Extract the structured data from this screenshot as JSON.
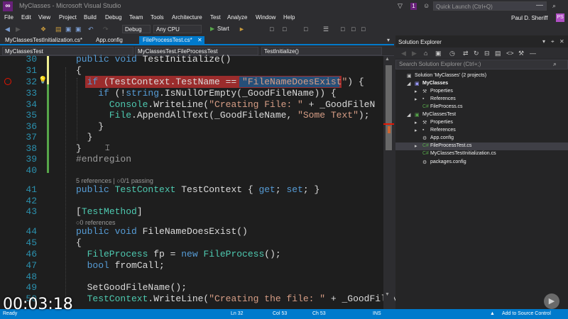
{
  "window": {
    "title": "MyClasses - Microsoft Visual Studio",
    "notification_count": "1",
    "quick_launch_placeholder": "Quick Launch (Ctrl+Q)",
    "user_name": "Paul D. Sheriff",
    "user_initials": "PS",
    "min_glyph": "—"
  },
  "menu": [
    "File",
    "Edit",
    "View",
    "Project",
    "Build",
    "Debug",
    "Team",
    "Tools",
    "Architecture",
    "Test",
    "Analyze",
    "Window",
    "Help"
  ],
  "toolbar": {
    "config": "Debug",
    "platform": "Any CPU",
    "start_label": "Start",
    "start_glyph": "▶",
    "icons": {
      "back": "◀",
      "forward": "▶",
      "new": "❖",
      "open": "▤",
      "save": "▣",
      "save_all": "▣",
      "undo": "↶",
      "redo": "↷",
      "attach": "►",
      "dropdown": "▾"
    }
  },
  "doc_tabs": [
    {
      "label": "MyClassesTestInitialization.cs*"
    },
    {
      "label": "App.config"
    },
    {
      "label": "FileProcessTest.cs*"
    }
  ],
  "nav": {
    "project": "MyClassesTest",
    "class": "MyClassesTest.FileProcessTest",
    "member": "TestInitialize()"
  },
  "editor": {
    "breakpoint_line": "32",
    "lines": [
      {
        "n": "30",
        "parts": [
          [
            "kw",
            "public "
          ],
          [
            "kw",
            "void "
          ],
          [
            "",
            "TestInitialize()"
          ]
        ]
      },
      {
        "n": "31",
        "parts": [
          [
            "",
            "{"
          ]
        ]
      },
      {
        "n": "32",
        "parts": [
          [
            "kw",
            "if "
          ],
          [
            "",
            "(TestContext.TestName == "
          ],
          [
            "str",
            "\"FileNameDoesExist\""
          ],
          [
            "",
            ") {"
          ]
        ]
      },
      {
        "n": "33",
        "parts": [
          [
            "kw",
            "if "
          ],
          [
            "",
            "(!"
          ],
          [
            "kw",
            "string"
          ],
          [
            "",
            ".IsNullOrEmpty(_GoodFileName)) {"
          ]
        ]
      },
      {
        "n": "34",
        "parts": [
          [
            "ty",
            "Console"
          ],
          [
            "",
            ".WriteLine("
          ],
          [
            "str",
            "\"Creating File: \""
          ],
          [
            "",
            " + _GoodFileN"
          ]
        ]
      },
      {
        "n": "35",
        "parts": [
          [
            "ty",
            "File"
          ],
          [
            "",
            ".AppendAllText(_GoodFileName, "
          ],
          [
            "str",
            "\"Some Text\""
          ],
          [
            "",
            ");"
          ]
        ]
      },
      {
        "n": "36",
        "parts": [
          [
            "",
            "}"
          ]
        ]
      },
      {
        "n": "37",
        "parts": [
          [
            "",
            "}"
          ]
        ]
      },
      {
        "n": "38",
        "parts": [
          [
            "",
            "}"
          ]
        ]
      },
      {
        "n": "39",
        "parts": [
          [
            "cm",
            "#endregion"
          ]
        ]
      },
      {
        "n": "40",
        "parts": [
          [
            "",
            ""
          ]
        ]
      },
      {
        "n": "41",
        "parts": [
          [
            "kw",
            "public "
          ],
          [
            "ty",
            "TestContext "
          ],
          [
            "",
            "TestContext { "
          ],
          [
            "kw",
            "get"
          ],
          [
            "",
            "; "
          ],
          [
            "kw",
            "set"
          ],
          [
            "",
            "; }"
          ]
        ]
      },
      {
        "n": "42",
        "parts": [
          [
            "",
            ""
          ]
        ]
      },
      {
        "n": "43",
        "parts": [
          [
            "",
            "["
          ],
          [
            "ty",
            "TestMethod"
          ],
          [
            "",
            "]"
          ]
        ]
      },
      {
        "n": "44",
        "parts": [
          [
            "kw",
            "public "
          ],
          [
            "kw",
            "void "
          ],
          [
            "",
            "FileNameDoesExist()"
          ]
        ]
      },
      {
        "n": "45",
        "parts": [
          [
            "",
            "{"
          ]
        ]
      },
      {
        "n": "46",
        "parts": [
          [
            "ty",
            "FileProcess "
          ],
          [
            "",
            "fp = "
          ],
          [
            "kw",
            "new "
          ],
          [
            "ty",
            "FileProcess"
          ],
          [
            "",
            "();"
          ]
        ]
      },
      {
        "n": "47",
        "parts": [
          [
            "kw",
            "bool "
          ],
          [
            "",
            "fromCall;"
          ]
        ]
      },
      {
        "n": "48",
        "parts": [
          [
            "",
            ""
          ]
        ]
      },
      {
        "n": "49",
        "parts": [
          [
            "",
            "SetGoodFileName();"
          ]
        ]
      },
      {
        "n": "50",
        "parts": [
          [
            "ty",
            "TestContext"
          ],
          [
            "",
            ".WriteLine("
          ],
          [
            "str",
            "\"Creating the file: \""
          ],
          [
            "",
            " + _GoodFileN"
          ]
        ]
      }
    ],
    "codelens_41": "5 references | ○0/1 passing",
    "codelens_44": "○0 references"
  },
  "solution_explorer": {
    "title": "Solution Explorer",
    "search_placeholder": "Search Solution Explorer (Ctrl+;)",
    "tree": [
      {
        "label": "Solution 'MyClasses' (2 projects)",
        "icon": "▣",
        "color": "#c5c5c5",
        "bold": false
      },
      {
        "label": "MyClasses",
        "icon": "▣",
        "color": "#9b9bff",
        "bold": true
      },
      {
        "label": "Properties",
        "icon": "⚒",
        "color": "#c5c5c5",
        "bold": false
      },
      {
        "label": "References",
        "icon": "▪",
        "color": "#c5c5c5",
        "bold": false
      },
      {
        "label": "FileProcess.cs",
        "icon": "C#",
        "color": "#57a64a",
        "bold": false
      },
      {
        "label": "MyClassesTest",
        "icon": "▣",
        "color": "#57a64a",
        "bold": false
      },
      {
        "label": "Properties",
        "icon": "⚒",
        "color": "#c5c5c5",
        "bold": false
      },
      {
        "label": "References",
        "icon": "▪",
        "color": "#c5c5c5",
        "bold": false
      },
      {
        "label": "App.config",
        "icon": "⚙",
        "color": "#c5c5c5",
        "bold": false
      },
      {
        "label": "FileProcessTest.cs",
        "icon": "C#",
        "color": "#57a64a",
        "bold": false
      },
      {
        "label": "MyClassesTestInitialization.cs",
        "icon": "C#",
        "color": "#57a64a",
        "bold": false
      },
      {
        "label": "packages.config",
        "icon": "⚙",
        "color": "#c5c5c5",
        "bold": false
      }
    ]
  },
  "status": {
    "ready": "Ready",
    "ln": "Ln 32",
    "col": "Col 53",
    "ch": "Ch 53",
    "ins": "INS",
    "source_control": "Add to Source Control",
    "up_glyph": "▲",
    "down_glyph": "▼"
  },
  "video_timestamp": "00:03:18",
  "colors": {
    "accent": "#007acc",
    "breakpoint": "#9b2c2c",
    "vs_purple": "#68217a"
  }
}
